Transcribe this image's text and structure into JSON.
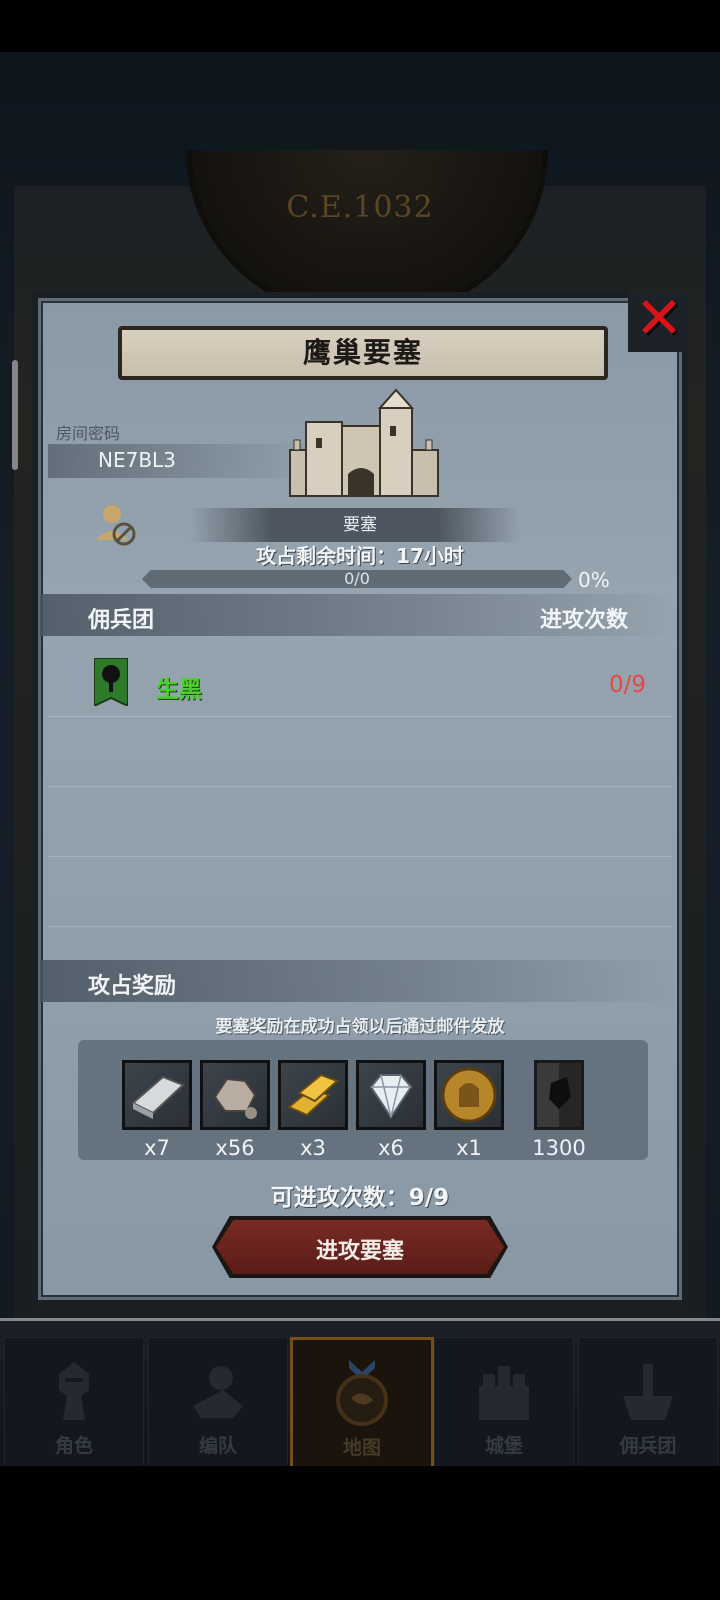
{
  "background": {
    "era": "C.E.1032"
  },
  "modal": {
    "title": "鹰巢要塞",
    "close_icon": "close-x-icon",
    "room": {
      "label": "房间密码",
      "code": "NE7BL3"
    },
    "fortress": {
      "icon": "castle-icon",
      "subtitle": "要塞",
      "time_left": "攻占剩余时间：17小时",
      "progress_text": "0/0",
      "progress_percent": "0%",
      "progress_fraction": 0
    },
    "mercenary_section": {
      "title": "佣兵团",
      "right_header": "进攻次数",
      "teams": [
        {
          "name": "生黑",
          "count": "0/9",
          "icon": "tree-banner-icon"
        }
      ]
    },
    "reward_section": {
      "title": "攻占奖励",
      "note": "要塞奖励在成功占领以后通过邮件发放",
      "items": [
        {
          "icon": "iron-ingot-icon",
          "qty": "x7",
          "color": "#cfd3d6"
        },
        {
          "icon": "stone-icon",
          "qty": "x56",
          "color": "#b8ada0"
        },
        {
          "icon": "gold-bars-icon",
          "qty": "x3",
          "color": "#d9a62a"
        },
        {
          "icon": "diamond-icon",
          "qty": "x6",
          "color": "#e9eef2"
        },
        {
          "icon": "knight-coin-icon",
          "qty": "x1",
          "color": "#b8862a"
        },
        {
          "icon": "banner-points-icon",
          "qty": "1300",
          "color": "#2a2a2a"
        }
      ]
    },
    "attempts": "可进攻次数：9/9",
    "attack_button": "进攻要塞"
  },
  "nav": {
    "items": [
      {
        "label": "角色",
        "icon": "knight-icon",
        "active": false
      },
      {
        "label": "编队",
        "icon": "formation-icon",
        "active": false
      },
      {
        "label": "地图",
        "icon": "map-icon",
        "active": true
      },
      {
        "label": "城堡",
        "icon": "castle-nav-icon",
        "active": false
      },
      {
        "label": "佣兵团",
        "icon": "mercenary-icon",
        "active": false
      }
    ]
  },
  "colors": {
    "accent_red": "#d8141a",
    "team_green": "#4bd02a",
    "count_red": "#e64646",
    "nav_active": "#b57a22"
  }
}
